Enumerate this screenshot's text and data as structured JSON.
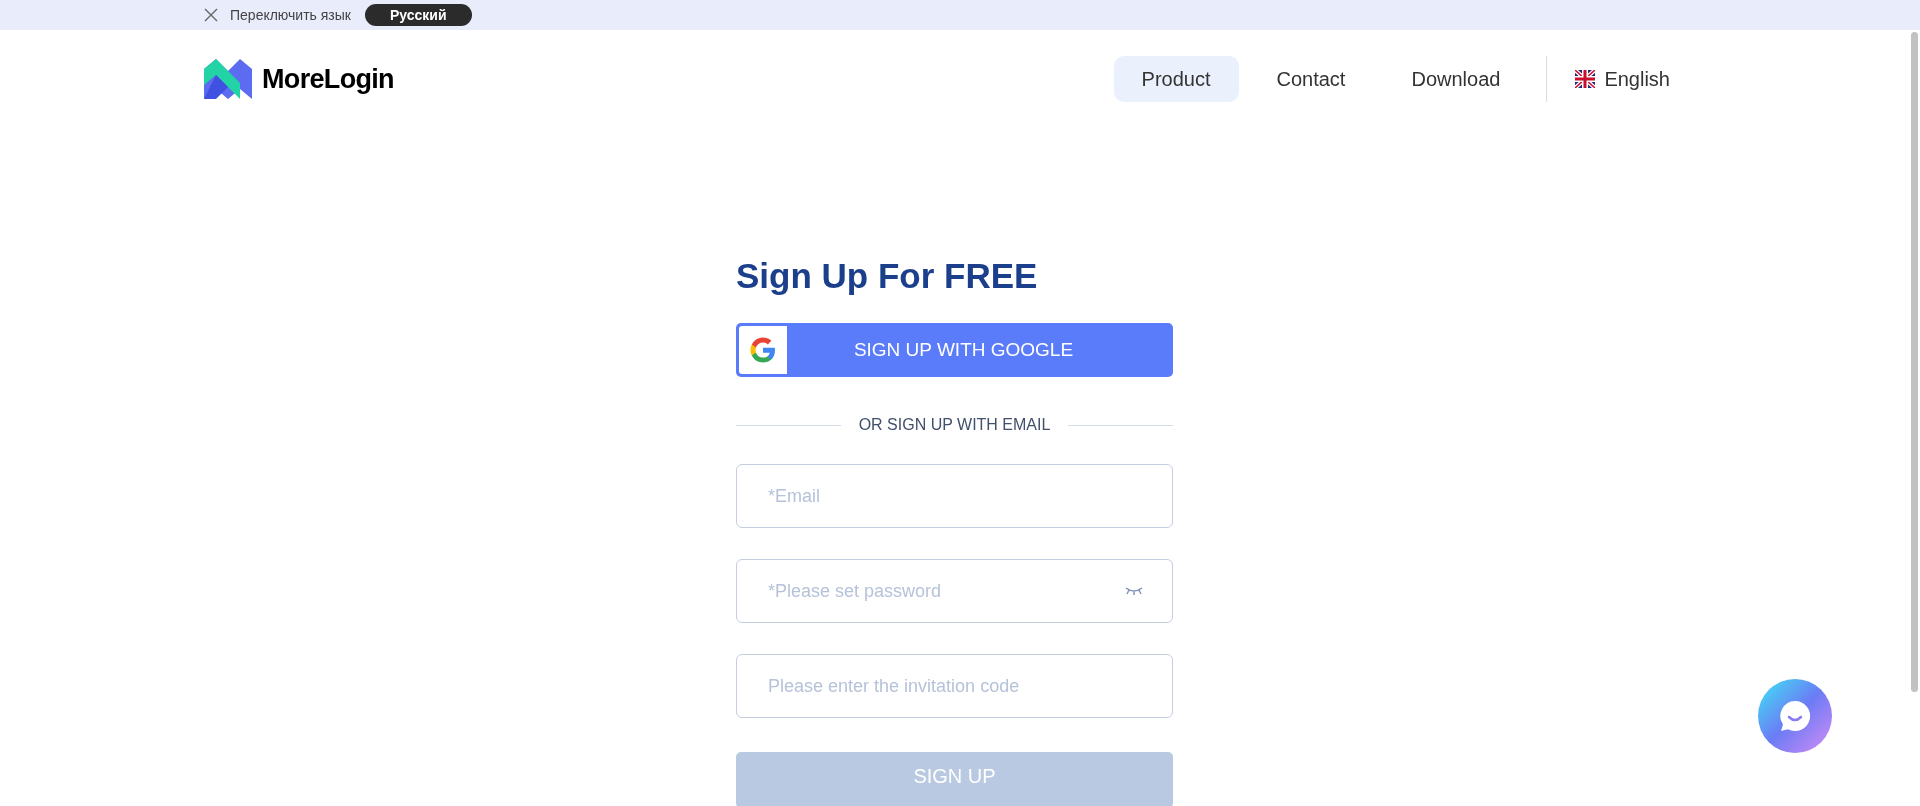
{
  "language_bar": {
    "label": "Переключить язык",
    "language_button": "Русский"
  },
  "header": {
    "logo_text": "MoreLogin",
    "nav": [
      {
        "label": "Product",
        "selected": true
      },
      {
        "label": "Contact",
        "selected": false
      },
      {
        "label": "Download",
        "selected": false
      }
    ],
    "language": "English"
  },
  "form": {
    "title": "Sign Up For FREE",
    "google_button": "SIGN UP WITH GOOGLE",
    "divider": "OR SIGN UP WITH EMAIL",
    "fields": [
      {
        "placeholder": "*Email",
        "kind": "text"
      },
      {
        "placeholder": "*Please set password",
        "kind": "password"
      },
      {
        "placeholder": "Please enter the invitation code",
        "kind": "text"
      }
    ],
    "submit": {
      "label": "SIGN UP",
      "disabled": true
    }
  }
}
